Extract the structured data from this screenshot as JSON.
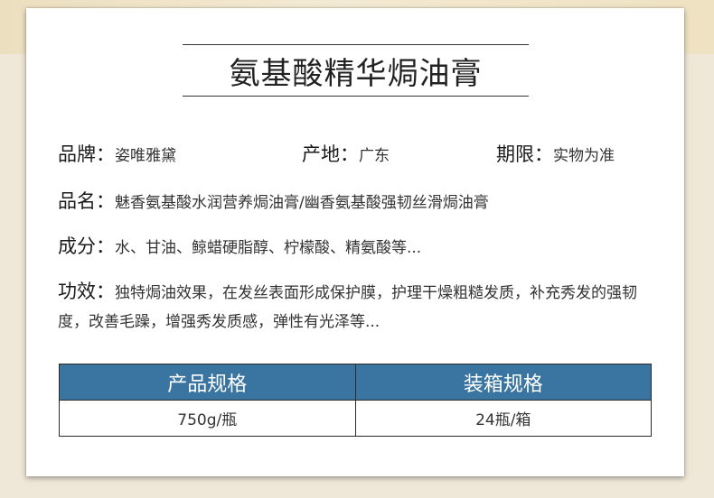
{
  "title": "氨基酸精华焗油膏",
  "info": {
    "brand_label": "品牌：",
    "brand_value": "姿唯雅黛",
    "origin_label": "产地：",
    "origin_value": "广东",
    "period_label": "期限：",
    "period_value": "实物为准",
    "name_label": "品名：",
    "name_value": "魅香氨基酸水润营养焗油膏/幽香氨基酸强韧丝滑焗油膏",
    "ingredients_label": "成分：",
    "ingredients_value": "水、甘油、鲸蜡硬脂醇、柠檬酸、精氨酸等...",
    "effect_label": "功效：",
    "effect_value": "独特焗油效果，在发丝表面形成保护膜，护理干燥粗糙发质，补充秀发的强韧度，改善毛躁，增强秀发质感，弹性有光泽等..."
  },
  "spec_table": {
    "headers": [
      "产品规格",
      "装箱规格"
    ],
    "rows": [
      [
        "750g/瓶",
        "24瓶/箱"
      ]
    ]
  },
  "colors": {
    "table_header": "#3a74a0",
    "background": "#efe7d8"
  }
}
